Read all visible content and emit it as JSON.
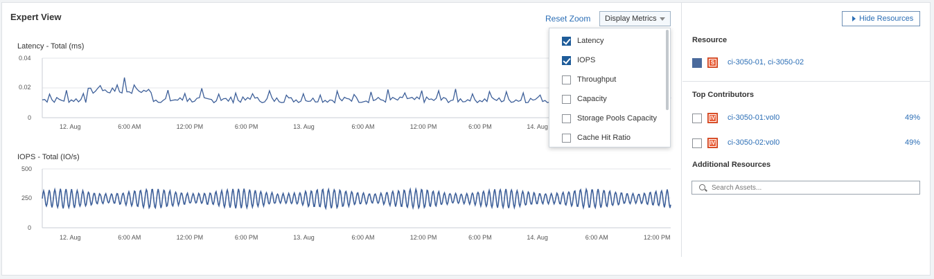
{
  "header": {
    "title": "Expert View",
    "reset_zoom": "Reset Zoom",
    "display_metrics": "Display Metrics"
  },
  "charts": {
    "latency": {
      "label": "Latency - Total (ms)",
      "y_ticks": [
        "0.04",
        "0.02",
        "0"
      ],
      "x_ticks": [
        "12. Aug",
        "6:00 AM",
        "12:00 PM",
        "6:00 PM",
        "13. Aug",
        "6:00 AM",
        "12:00 PM",
        "6:00 PM",
        "14. Aug"
      ]
    },
    "iops": {
      "label": "IOPS - Total (IO/s)",
      "y_ticks": [
        "500",
        "250",
        "0"
      ],
      "x_ticks": [
        "12. Aug",
        "6:00 AM",
        "12:00 PM",
        "6:00 PM",
        "13. Aug",
        "6:00 AM",
        "12:00 PM",
        "6:00 PM",
        "14. Aug",
        "6:00 AM",
        "12:00 PM"
      ]
    }
  },
  "chart_data": [
    {
      "type": "line",
      "ylabel": "Latency - Total (ms)",
      "ylim": [
        0,
        0.04
      ],
      "x": [
        "12. Aug",
        "6:00 AM",
        "12:00 PM",
        "6:00 PM",
        "13. Aug",
        "6:00 AM",
        "12:00 PM",
        "6:00 PM",
        "14. Aug"
      ],
      "series": [
        {
          "values": [
            0.012,
            0.02,
            0.026,
            0.013,
            0.015,
            0.014,
            0.016,
            0.014,
            0.013
          ]
        }
      ],
      "grid": true
    },
    {
      "type": "line",
      "ylabel": "IOPS - Total (IO/s)",
      "ylim": [
        0,
        500
      ],
      "x": [
        "12. Aug",
        "6:00 AM",
        "12:00 PM",
        "6:00 PM",
        "13. Aug",
        "6:00 AM",
        "12:00 PM",
        "6:00 PM",
        "14. Aug",
        "6:00 AM",
        "12:00 PM"
      ],
      "series": [
        {
          "values": [
            240,
            250,
            245,
            250,
            255,
            250,
            245,
            250,
            255,
            250,
            245
          ]
        }
      ],
      "grid": true
    }
  ],
  "dropdown": {
    "items": [
      {
        "label": "Latency",
        "checked": true
      },
      {
        "label": "IOPS",
        "checked": true
      },
      {
        "label": "Throughput",
        "checked": false
      },
      {
        "label": "Capacity",
        "checked": false
      },
      {
        "label": "Storage Pools Capacity",
        "checked": false
      },
      {
        "label": "Cache Hit Ratio",
        "checked": false
      }
    ]
  },
  "sidebar": {
    "hide_resources": "Hide Resources",
    "resource_heading": "Resource",
    "resource_badge": "S",
    "resource_link": "ci-3050-01,  ci-3050-02",
    "resource_color": "#4a6a9c",
    "top_contributors_heading": "Top Contributors",
    "contributors": [
      {
        "badge": "IV",
        "name": "ci-3050-01:vol0",
        "pct": "49%"
      },
      {
        "badge": "IV",
        "name": "ci-3050-02:vol0",
        "pct": "49%"
      }
    ],
    "additional_heading": "Additional Resources",
    "search_placeholder": "Search Assets..."
  },
  "colors": {
    "series": "#3d5f99",
    "link": "#2a6db5",
    "badge": "#e85a33"
  }
}
